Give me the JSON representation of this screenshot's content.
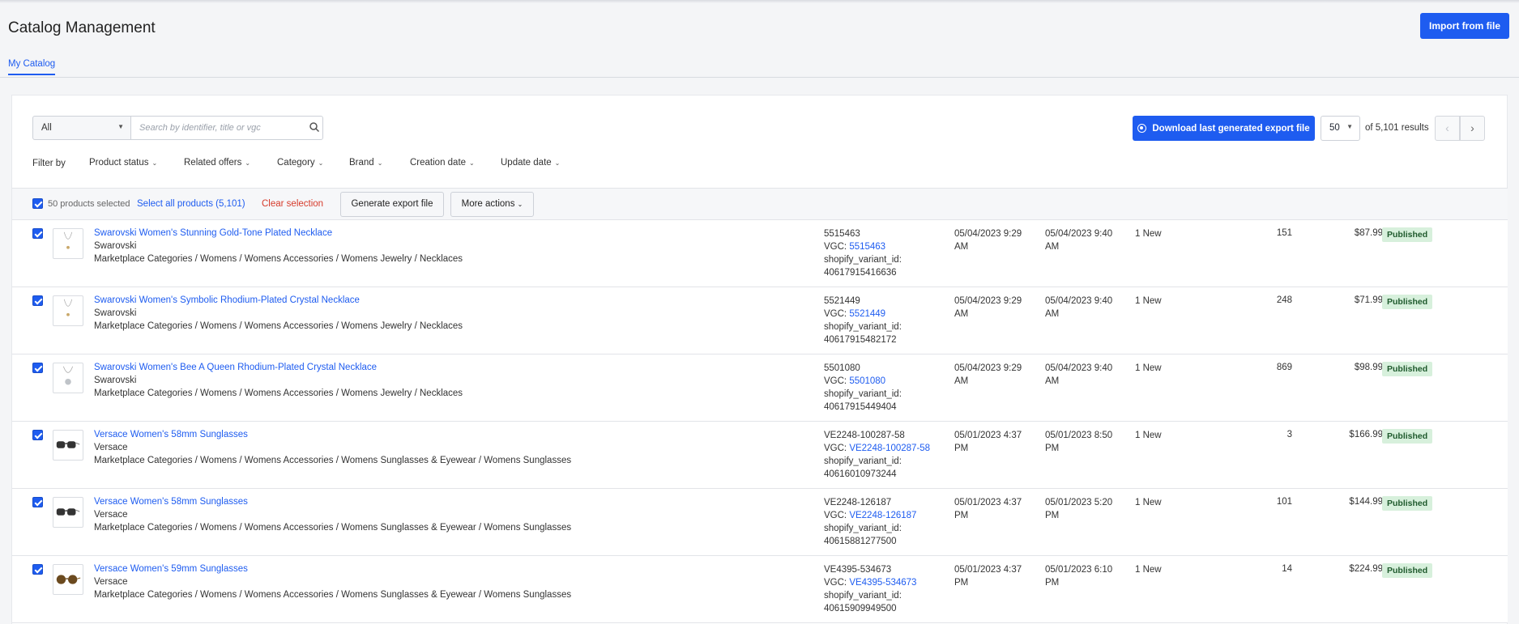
{
  "header": {
    "title": "Catalog Management",
    "import_label": "Import from file"
  },
  "tabs": [
    {
      "label": "My Catalog"
    }
  ],
  "toolbar": {
    "scope_value": "All",
    "search_placeholder": "Search by identifier, title or vgc",
    "download_label": "Download last generated export file",
    "per_page": "50",
    "results_text": "of 5,101 results",
    "prev_icon": "‹",
    "next_icon": "›"
  },
  "filters": {
    "label": "Filter by",
    "items": [
      "Product status",
      "Related offers",
      "Category",
      "Brand",
      "Creation date",
      "Update date"
    ]
  },
  "bulk": {
    "selected_text": "50 products selected",
    "select_all": "Select all products (5,101)",
    "clear": "Clear selection",
    "generate": "Generate export file",
    "more": "More actions"
  },
  "rows": [
    {
      "title": "Swarovski Women's Stunning Gold-Tone Plated Necklace",
      "brand": "Swarovski",
      "category": "Marketplace Categories / Womens / Womens Accessories / Womens Jewelry / Necklaces",
      "identifier": "5515463",
      "vgc_label": "VGC: ",
      "vgc": "5515463",
      "variant_label": "shopify_variant_id:",
      "variant_id": "40617915416636",
      "created_1": "05/04/2023 9:29",
      "created_2": "AM",
      "updated_1": "05/04/2023 9:40",
      "updated_2": "AM",
      "offers": "1 New",
      "quantity": "151",
      "price": "$87.99",
      "status": "Published",
      "thumb_icon": "necklace-icon"
    },
    {
      "title": "Swarovski Women's Symbolic Rhodium-Plated Crystal Necklace",
      "brand": "Swarovski",
      "category": "Marketplace Categories / Womens / Womens Accessories / Womens Jewelry / Necklaces",
      "identifier": "5521449",
      "vgc_label": "VGC: ",
      "vgc": "5521449",
      "variant_label": "shopify_variant_id:",
      "variant_id": "40617915482172",
      "created_1": "05/04/2023 9:29",
      "created_2": "AM",
      "updated_1": "05/04/2023 9:40",
      "updated_2": "AM",
      "offers": "1 New",
      "quantity": "248",
      "price": "$71.99",
      "status": "Published",
      "thumb_icon": "necklace-icon"
    },
    {
      "title": "Swarovski Women's Bee A Queen Rhodium-Plated Crystal Necklace",
      "brand": "Swarovski",
      "category": "Marketplace Categories / Womens / Womens Accessories / Womens Jewelry / Necklaces",
      "identifier": "5501080",
      "vgc_label": "VGC: ",
      "vgc": "5501080",
      "variant_label": "shopify_variant_id:",
      "variant_id": "40617915449404",
      "created_1": "05/04/2023 9:29",
      "created_2": "AM",
      "updated_1": "05/04/2023 9:40",
      "updated_2": "AM",
      "offers": "1 New",
      "quantity": "869",
      "price": "$98.99",
      "status": "Published",
      "thumb_icon": "pendant-icon"
    },
    {
      "title": "Versace Women's 58mm Sunglasses",
      "brand": "Versace",
      "category": "Marketplace Categories / Womens / Womens Accessories / Womens Sunglasses & Eyewear / Womens Sunglasses",
      "identifier": "VE2248-100287-58",
      "vgc_label": "VGC: ",
      "vgc": "VE2248-100287-58",
      "variant_label": "shopify_variant_id:",
      "variant_id": "40616010973244",
      "created_1": "05/01/2023 4:37",
      "created_2": "PM",
      "updated_1": "05/01/2023 8:50",
      "updated_2": "PM",
      "offers": "1 New",
      "quantity": "3",
      "price": "$166.99",
      "status": "Published",
      "thumb_icon": "sunglasses-icon"
    },
    {
      "title": "Versace Women's 58mm Sunglasses",
      "brand": "Versace",
      "category": "Marketplace Categories / Womens / Womens Accessories / Womens Sunglasses & Eyewear / Womens Sunglasses",
      "identifier": "VE2248-126187",
      "vgc_label": "VGC: ",
      "vgc": "VE2248-126187",
      "variant_label": "shopify_variant_id:",
      "variant_id": "40615881277500",
      "created_1": "05/01/2023 4:37",
      "created_2": "PM",
      "updated_1": "05/01/2023 5:20",
      "updated_2": "PM",
      "offers": "1 New",
      "quantity": "101",
      "price": "$144.99",
      "status": "Published",
      "thumb_icon": "sunglasses-icon"
    },
    {
      "title": "Versace Women's 59mm Sunglasses",
      "brand": "Versace",
      "category": "Marketplace Categories / Womens / Womens Accessories / Womens Sunglasses & Eyewear / Womens Sunglasses",
      "identifier": "VE4395-534673",
      "vgc_label": "VGC: ",
      "vgc": "VE4395-534673",
      "variant_label": "shopify_variant_id:",
      "variant_id": "40615909949500",
      "created_1": "05/01/2023 4:37",
      "created_2": "PM",
      "updated_1": "05/01/2023 6:10",
      "updated_2": "PM",
      "offers": "1 New",
      "quantity": "14",
      "price": "$224.99",
      "status": "Published",
      "thumb_icon": "tortoise-sunglasses-icon"
    }
  ],
  "colors": {
    "accent": "#1e5cf0",
    "danger": "#d63b2b",
    "published_bg": "#d7f0dc"
  }
}
